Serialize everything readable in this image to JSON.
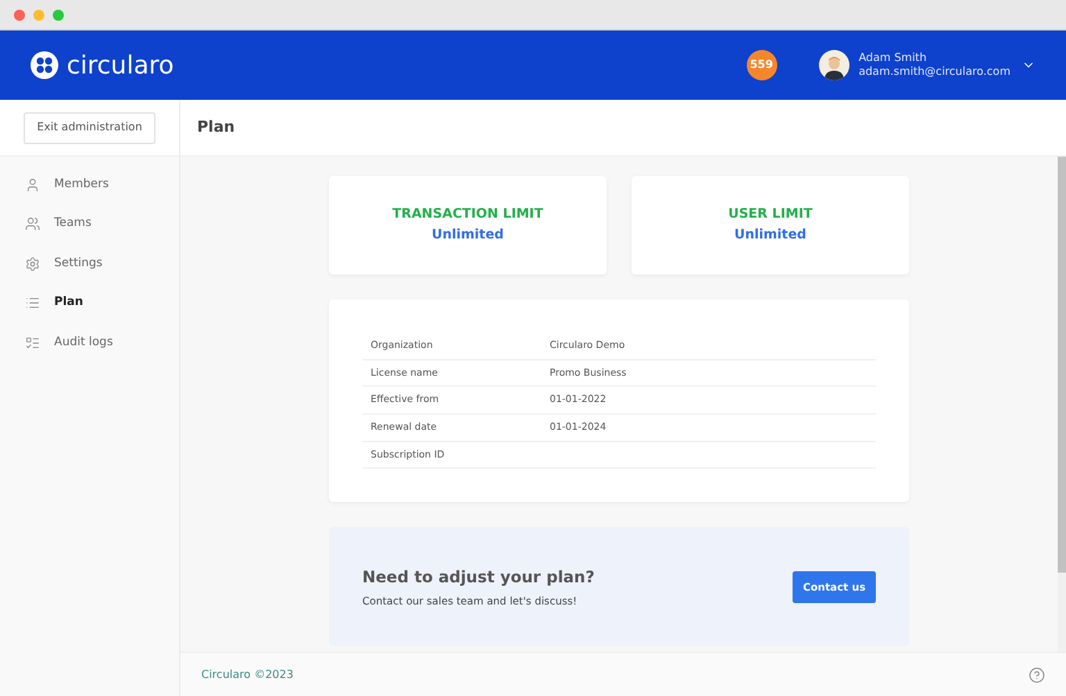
{
  "header": {
    "brand": "circularo",
    "badge": "559",
    "user": {
      "name": "Adam Smith",
      "email": "adam.smith@circularo.com"
    }
  },
  "sidebar": {
    "exit_button": "Exit administration",
    "items": [
      {
        "label": "Members",
        "selected": false
      },
      {
        "label": "Teams",
        "selected": false
      },
      {
        "label": "Settings",
        "selected": false
      },
      {
        "label": "Plan",
        "selected": true
      },
      {
        "label": "Audit logs",
        "selected": false
      }
    ]
  },
  "page_title": "Plan",
  "limits": [
    {
      "title": "TRANSACTION LIMIT",
      "value": "Unlimited"
    },
    {
      "title": "USER LIMIT",
      "value": "Unlimited"
    }
  ],
  "details": [
    {
      "label": "Organization",
      "value": "Circularo Demo"
    },
    {
      "label": "License name",
      "value": "Promo Business"
    },
    {
      "label": "Effective from",
      "value": "01-01-2022"
    },
    {
      "label": "Renewal date",
      "value": "01-01-2024"
    },
    {
      "label": "Subscription ID"
    }
  ],
  "cta": {
    "title": "Need to adjust your plan?",
    "text": "Contact our sales team and let's discuss!",
    "button": "Contact us"
  },
  "footer": "Circularo ©2023"
}
